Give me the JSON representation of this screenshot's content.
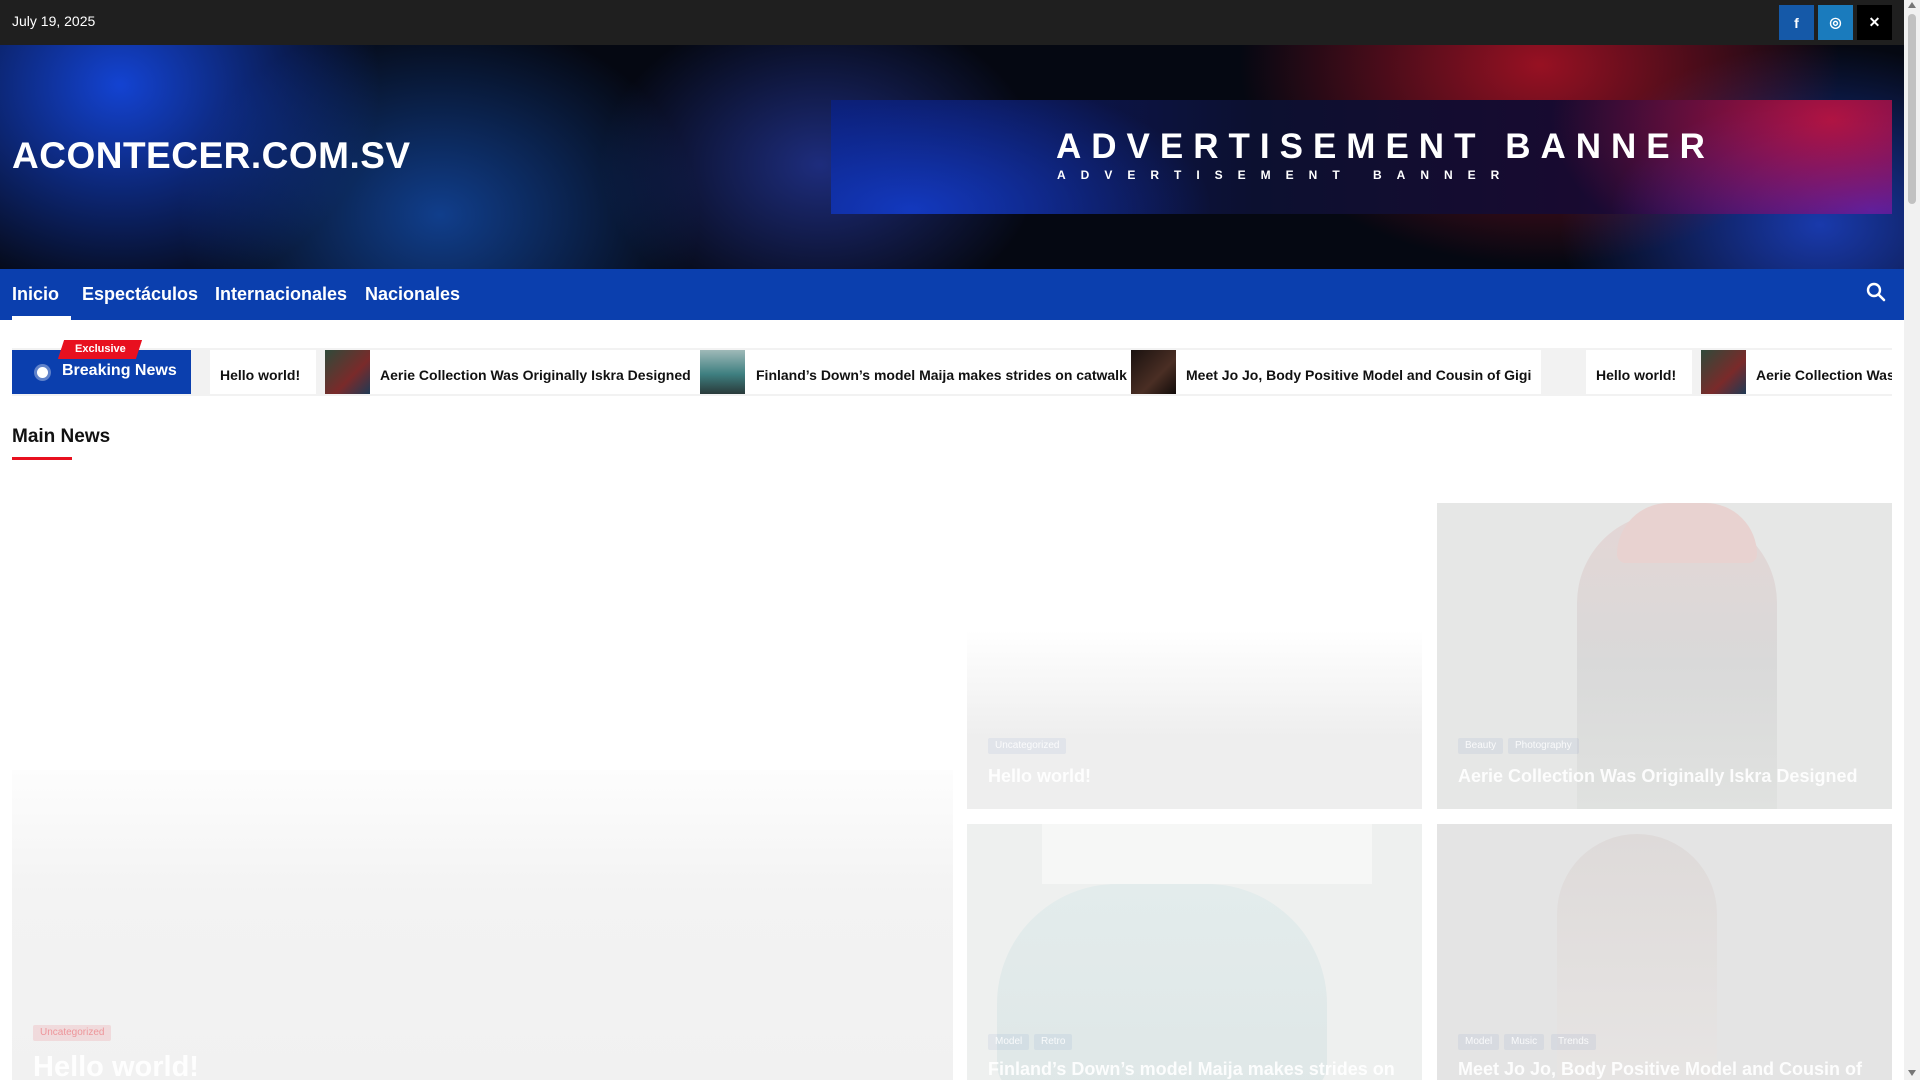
{
  "topbar": {
    "date": "July 19, 2025",
    "social": [
      {
        "name": "facebook-icon",
        "glyph": "f"
      },
      {
        "name": "instagram-icon",
        "glyph": "◎"
      },
      {
        "name": "x-icon",
        "glyph": "✕"
      }
    ]
  },
  "header": {
    "site_title": "ACONTECER.COM.SV",
    "ad_big": "ADVERTISEMENT BANNER",
    "ad_small": "ADVERTISEMENT BANNER"
  },
  "nav": {
    "items": [
      "Inicio",
      "Espectáculos",
      "Internacionales",
      "Nacionales"
    ],
    "active": "Inicio",
    "search_icon": "search-icon"
  },
  "ticker": {
    "badge": "Exclusive",
    "label": "Breaking News",
    "items": [
      "Hello world!",
      "Aerie Collection Was Originally Iskra Designed",
      "Finland’s Down’s model Maija makes strides on catwalk",
      "Meet Jo Jo, Body Positive Model and Cousin of Gigi",
      "Hello world!",
      "Aerie Collection Was O"
    ]
  },
  "main": {
    "section_title": "Main News",
    "featured": {
      "category": "Uncategorized",
      "title": "Hello world!"
    },
    "grid": [
      {
        "categories": [
          "Uncategorized"
        ],
        "title": "Hello world!"
      },
      {
        "categories": [
          "Beauty",
          "Photography"
        ],
        "title": "Aerie Collection Was Originally Iskra Designed"
      },
      {
        "categories": [
          "Model",
          "Retro"
        ],
        "title": "Finland’s Down’s model Maija makes strides on"
      },
      {
        "categories": [
          "Model",
          "Music",
          "Trends"
        ],
        "title": "Meet Jo Jo, Body Positive Model and Cousin of"
      }
    ]
  },
  "colors": {
    "accent_blue": "#0b3fae",
    "accent_red": "#e8101f",
    "topbar_bg": "#1f1f1f"
  }
}
